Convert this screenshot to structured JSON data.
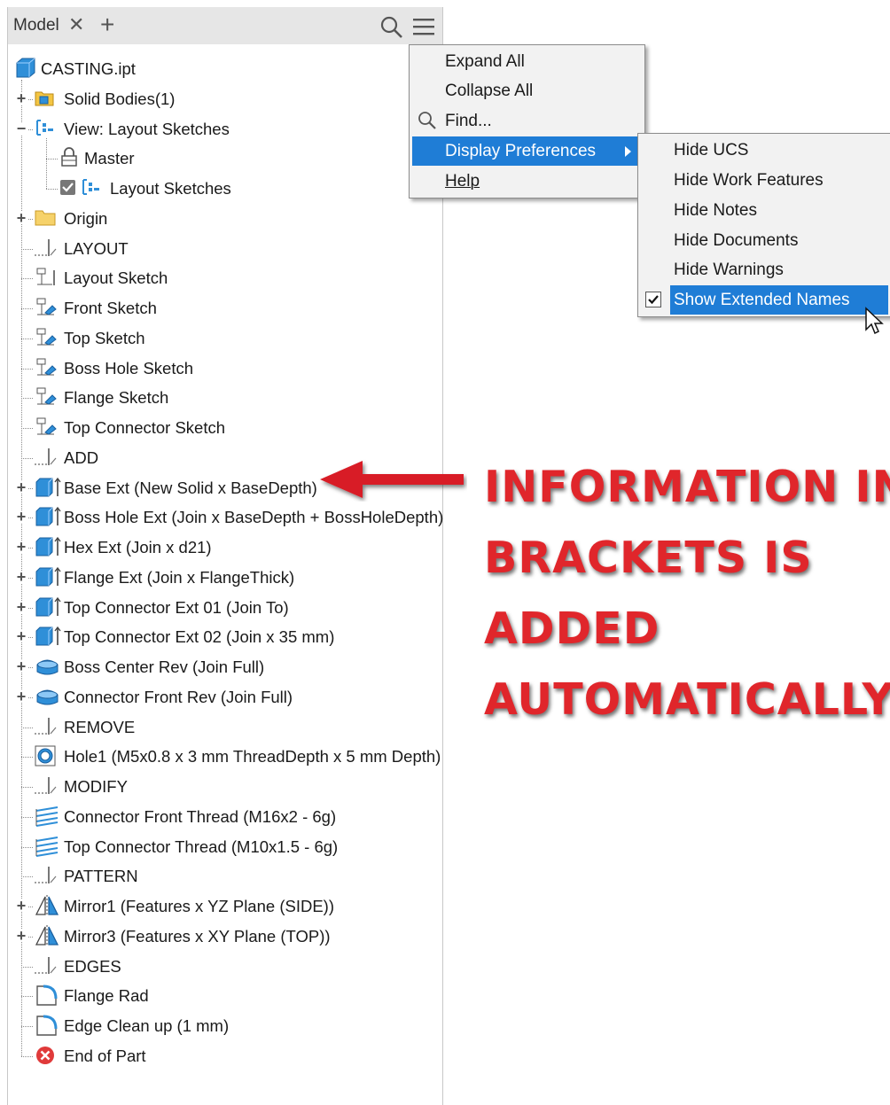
{
  "tab": {
    "label": "Model"
  },
  "tree": {
    "root": "CASTING.ipt",
    "items": [
      {
        "label": "Solid Bodies(1)"
      },
      {
        "label": "View: Layout Sketches"
      },
      {
        "label": "Master"
      },
      {
        "label": "Layout Sketches"
      },
      {
        "label": "Origin"
      },
      {
        "label": "LAYOUT"
      },
      {
        "label": "Layout Sketch"
      },
      {
        "label": "Front Sketch"
      },
      {
        "label": "Top Sketch"
      },
      {
        "label": "Boss Hole Sketch"
      },
      {
        "label": "Flange Sketch"
      },
      {
        "label": "Top Connector Sketch"
      },
      {
        "label": "ADD"
      },
      {
        "label": "Base Ext (New Solid x BaseDepth)"
      },
      {
        "label": "Boss Hole Ext (Join x BaseDepth + BossHoleDepth)"
      },
      {
        "label": "Hex Ext (Join x d21)"
      },
      {
        "label": "Flange Ext (Join x FlangeThick)"
      },
      {
        "label": "Top Connector Ext 01 (Join To)"
      },
      {
        "label": "Top Connector Ext 02 (Join x 35 mm)"
      },
      {
        "label": "Boss Center Rev (Join Full)"
      },
      {
        "label": "Connector Front Rev (Join Full)"
      },
      {
        "label": "REMOVE"
      },
      {
        "label": "Hole1 (M5x0.8 x 3 mm ThreadDepth x 5 mm Depth)"
      },
      {
        "label": "MODIFY"
      },
      {
        "label": "Connector Front Thread (M16x2 - 6g)"
      },
      {
        "label": "Top Connector Thread (M10x1.5 - 6g)"
      },
      {
        "label": "PATTERN"
      },
      {
        "label": "Mirror1 (Features x YZ Plane (SIDE))"
      },
      {
        "label": "Mirror3 (Features x XY Plane (TOP))"
      },
      {
        "label": "EDGES"
      },
      {
        "label": "Flange Rad"
      },
      {
        "label": "Edge Clean up (1 mm)"
      },
      {
        "label": "End of Part"
      }
    ]
  },
  "menu": {
    "items": [
      "Expand All",
      "Collapse All",
      "Find...",
      "Display Preferences",
      "Help"
    ]
  },
  "submenu": {
    "items": [
      "Hide UCS",
      "Hide Work Features",
      "Hide Notes",
      "Hide Documents",
      "Hide Warnings",
      "Show Extended Names"
    ]
  },
  "callout": {
    "lines": [
      "INFORMATION IN",
      "BRACKETS IS",
      "ADDED",
      "AUTOMATICALLY"
    ]
  },
  "colors": {
    "highlight": "#1f7dd6",
    "callout": "#e0262b",
    "part_blue": "#2f8fd8",
    "folder": "#f4c542"
  }
}
